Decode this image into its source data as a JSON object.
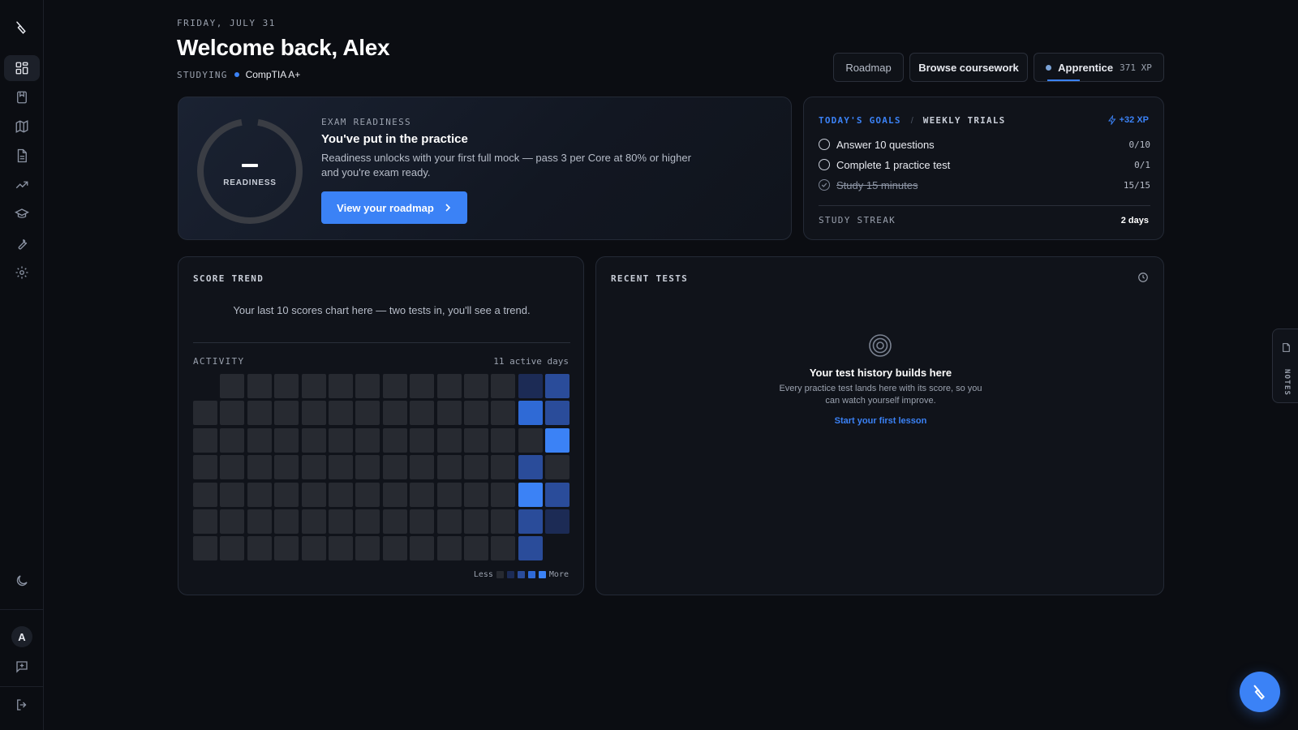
{
  "header": {
    "date": "FRIDAY, JULY 31",
    "welcome": "Welcome back, Alex",
    "studying_label": "STUDYING",
    "studying_value": "CompTIA A+"
  },
  "toolbar": {
    "roadmap_label": "Roadmap",
    "browse_label": "Browse coursework",
    "rank_name": "Apprentice",
    "rank_xp": "371 XP"
  },
  "readiness": {
    "ring_value": "–",
    "ring_label": "READINESS",
    "eyebrow": "EXAM READINESS",
    "title": "You've put in the practice",
    "description": "Readiness unlocks with your first full mock — pass 3 per Core at 80% or higher and you're exam ready.",
    "cta_label": "View your roadmap"
  },
  "goals": {
    "tab_today": "TODAY'S GOALS",
    "separator": "/",
    "tab_weekly": "WEEKLY TRIALS",
    "xp": "+32 XP",
    "items": [
      {
        "label": "Answer 10 questions",
        "count": "0/10",
        "done": false
      },
      {
        "label": "Complete 1 practice test",
        "count": "0/1",
        "done": false
      },
      {
        "label": "Study 15 minutes",
        "count": "15/15",
        "done": true
      }
    ],
    "streak_label": "STUDY STREAK",
    "streak_value": "2 days"
  },
  "trend": {
    "eyebrow": "SCORE TREND",
    "message": "Your last 10 scores chart here — two tests in, you'll see a trend.",
    "activity_label": "ACTIVITY",
    "activity_count": "11 active days",
    "legend_less": "Less",
    "legend_more": "More",
    "heatmap": [
      [
        -1,
        0,
        0,
        0,
        0,
        0,
        0,
        0,
        0,
        0,
        0,
        0,
        1,
        2
      ],
      [
        0,
        0,
        0,
        0,
        0,
        0,
        0,
        0,
        0,
        0,
        0,
        0,
        3,
        2
      ],
      [
        0,
        0,
        0,
        0,
        0,
        0,
        0,
        0,
        0,
        0,
        0,
        0,
        0,
        4
      ],
      [
        0,
        0,
        0,
        0,
        0,
        0,
        0,
        0,
        0,
        0,
        0,
        0,
        2,
        0
      ],
      [
        0,
        0,
        0,
        0,
        0,
        0,
        0,
        0,
        0,
        0,
        0,
        0,
        4,
        2
      ],
      [
        0,
        0,
        0,
        0,
        0,
        0,
        0,
        0,
        0,
        0,
        0,
        0,
        2,
        1
      ],
      [
        0,
        0,
        0,
        0,
        0,
        0,
        0,
        0,
        0,
        0,
        0,
        0,
        2,
        -1
      ]
    ]
  },
  "recent": {
    "eyebrow": "RECENT TESTS",
    "empty_title": "Your test history builds here",
    "empty_desc": "Every practice test lands here with its score, so you can watch yourself improve.",
    "empty_link": "Start your first lesson"
  },
  "sidebar": {
    "avatar_initial": "A",
    "items": [
      "logo-icon",
      "dashboard-icon",
      "bookmark-icon",
      "map-icon",
      "document-icon",
      "trend-icon",
      "graduation-cap-icon",
      "wrench-icon",
      "gear-icon"
    ]
  },
  "notes": {
    "label": "NOTES"
  },
  "colors": {
    "accent": "#3b82f6",
    "background": "#0b0d12",
    "card": "#10131a"
  }
}
